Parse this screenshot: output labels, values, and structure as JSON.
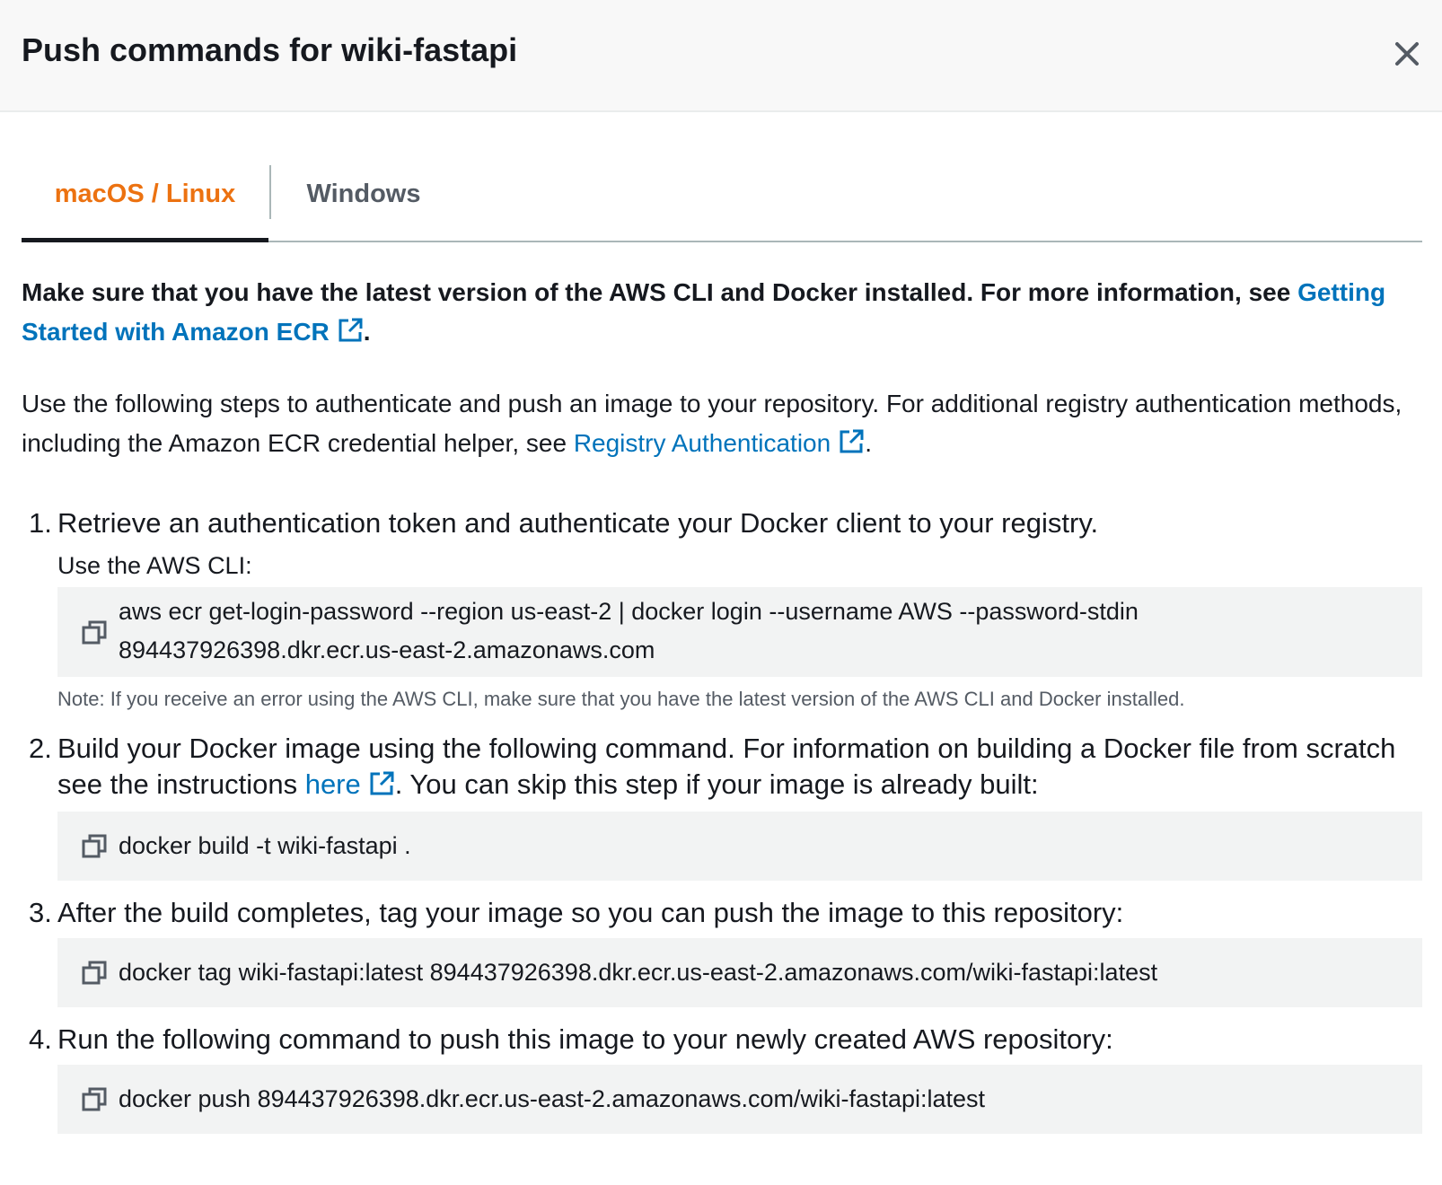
{
  "modal": {
    "title": "Push commands for wiki-fastapi",
    "close_icon": "close-icon"
  },
  "tabs": [
    {
      "label": "macOS / Linux",
      "active": true
    },
    {
      "label": "Windows",
      "active": false
    }
  ],
  "colors": {
    "active_tab": "#ec7211",
    "link": "#0073bb",
    "code_bg": "#f2f3f3"
  },
  "intro": {
    "bold_text": "Make sure that you have the latest version of the AWS CLI and Docker installed. For more information, see ",
    "bold_link": "Getting Started with Amazon ECR",
    "bold_end": ".",
    "text": "Use the following steps to authenticate and push an image to your repository. For additional registry authentication methods, including the Amazon ECR credential helper, see ",
    "link": "Registry Authentication",
    "end": "."
  },
  "steps": [
    {
      "number": "1.",
      "text": "Retrieve an authentication token and authenticate your Docker client to your registry.",
      "sub_label": "Use the AWS CLI:",
      "command_line1": "aws ecr get-login-password --region us-east-2 | docker login --username AWS --password-stdin",
      "command_line2": "894437926398.dkr.ecr.us-east-2.amazonaws.com",
      "note": "Note: If you receive an error using the AWS CLI, make sure that you have the latest version of the AWS CLI and Docker installed."
    },
    {
      "number": "2.",
      "text_before": "Build your Docker image using the following command. For information on building a Docker file from scratch see the instructions ",
      "link": "here",
      "text_after": ". You can skip this step if your image is already built:",
      "command": "docker build -t wiki-fastapi ."
    },
    {
      "number": "3.",
      "text": "After the build completes, tag your image so you can push the image to this repository:",
      "command": "docker tag wiki-fastapi:latest 894437926398.dkr.ecr.us-east-2.amazonaws.com/wiki-fastapi:latest"
    },
    {
      "number": "4.",
      "text": "Run the following command to push this image to your newly created AWS repository:",
      "command": "docker push 894437926398.dkr.ecr.us-east-2.amazonaws.com/wiki-fastapi:latest"
    }
  ]
}
